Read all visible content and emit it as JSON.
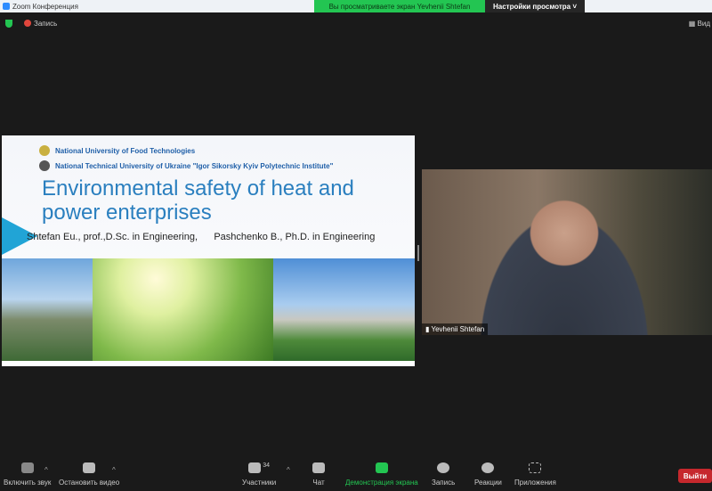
{
  "window": {
    "title": "Zoom Конференция"
  },
  "banner": {
    "text": "Вы просматриваете экран Yevhenii Shtefan",
    "view_options": "Настройки просмотра ˅"
  },
  "topbar": {
    "recording": "Запись",
    "view": "Вид"
  },
  "slide": {
    "universities": [
      "National University of Food Technologies",
      "National Technical University of Ukraine \"Igor Sikorsky Kyiv Polytechnic Institute\""
    ],
    "title": "Environmental safety of heat and power enterprises",
    "authors": "Shtefan Eu., prof.,D.Sc. in Engineering,      Pashchenko B., Ph.D. in Engineering"
  },
  "video": {
    "name": "Yevhenii Shtefan"
  },
  "toolbar": {
    "unmute": "Включить звук",
    "stop_video": "Остановить видео",
    "participants": "Участники",
    "participants_count": "34",
    "chat": "Чат",
    "share": "Демонстрация экрана",
    "record": "Запись",
    "reactions": "Реакции",
    "apps": "Приложения",
    "leave": "Выйти"
  },
  "colors": {
    "accent_green": "#23c552",
    "leave_red": "#c6282d",
    "title_blue": "#2a7fbf"
  }
}
